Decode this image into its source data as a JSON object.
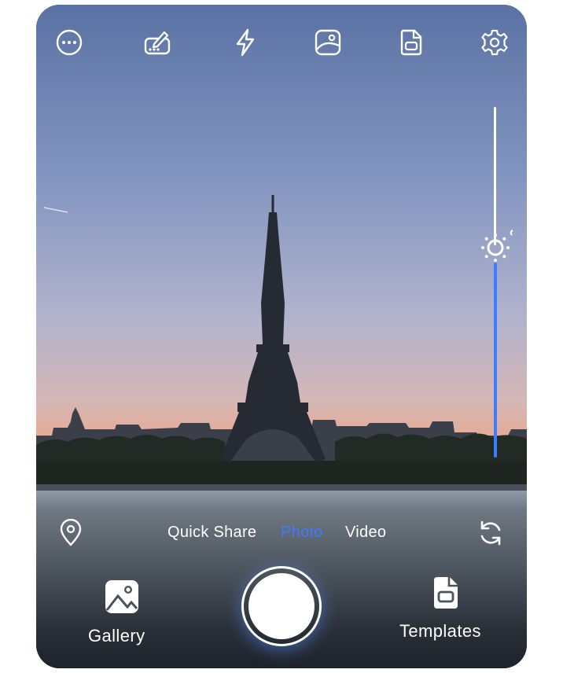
{
  "toolbar": {
    "items": [
      {
        "icon": "more-icon"
      },
      {
        "icon": "signature-icon"
      },
      {
        "icon": "flash-icon"
      },
      {
        "icon": "image-icon"
      },
      {
        "icon": "document-scan-icon"
      },
      {
        "icon": "settings-gear-icon"
      }
    ]
  },
  "exposure": {
    "level": 0.4,
    "icon": "sun-icon"
  },
  "modes": {
    "items": [
      "Quick Share",
      "Photo",
      "Video"
    ],
    "active": "Photo"
  },
  "bottom": {
    "location_icon": "location-pin-icon",
    "flip_icon": "camera-flip-icon",
    "gallery_label": "Gallery",
    "templates_label": "Templates"
  },
  "colors": {
    "accent": "#3d7bff",
    "sky_top": "#5d76a6",
    "sky_horizon": "#f0a07a"
  }
}
